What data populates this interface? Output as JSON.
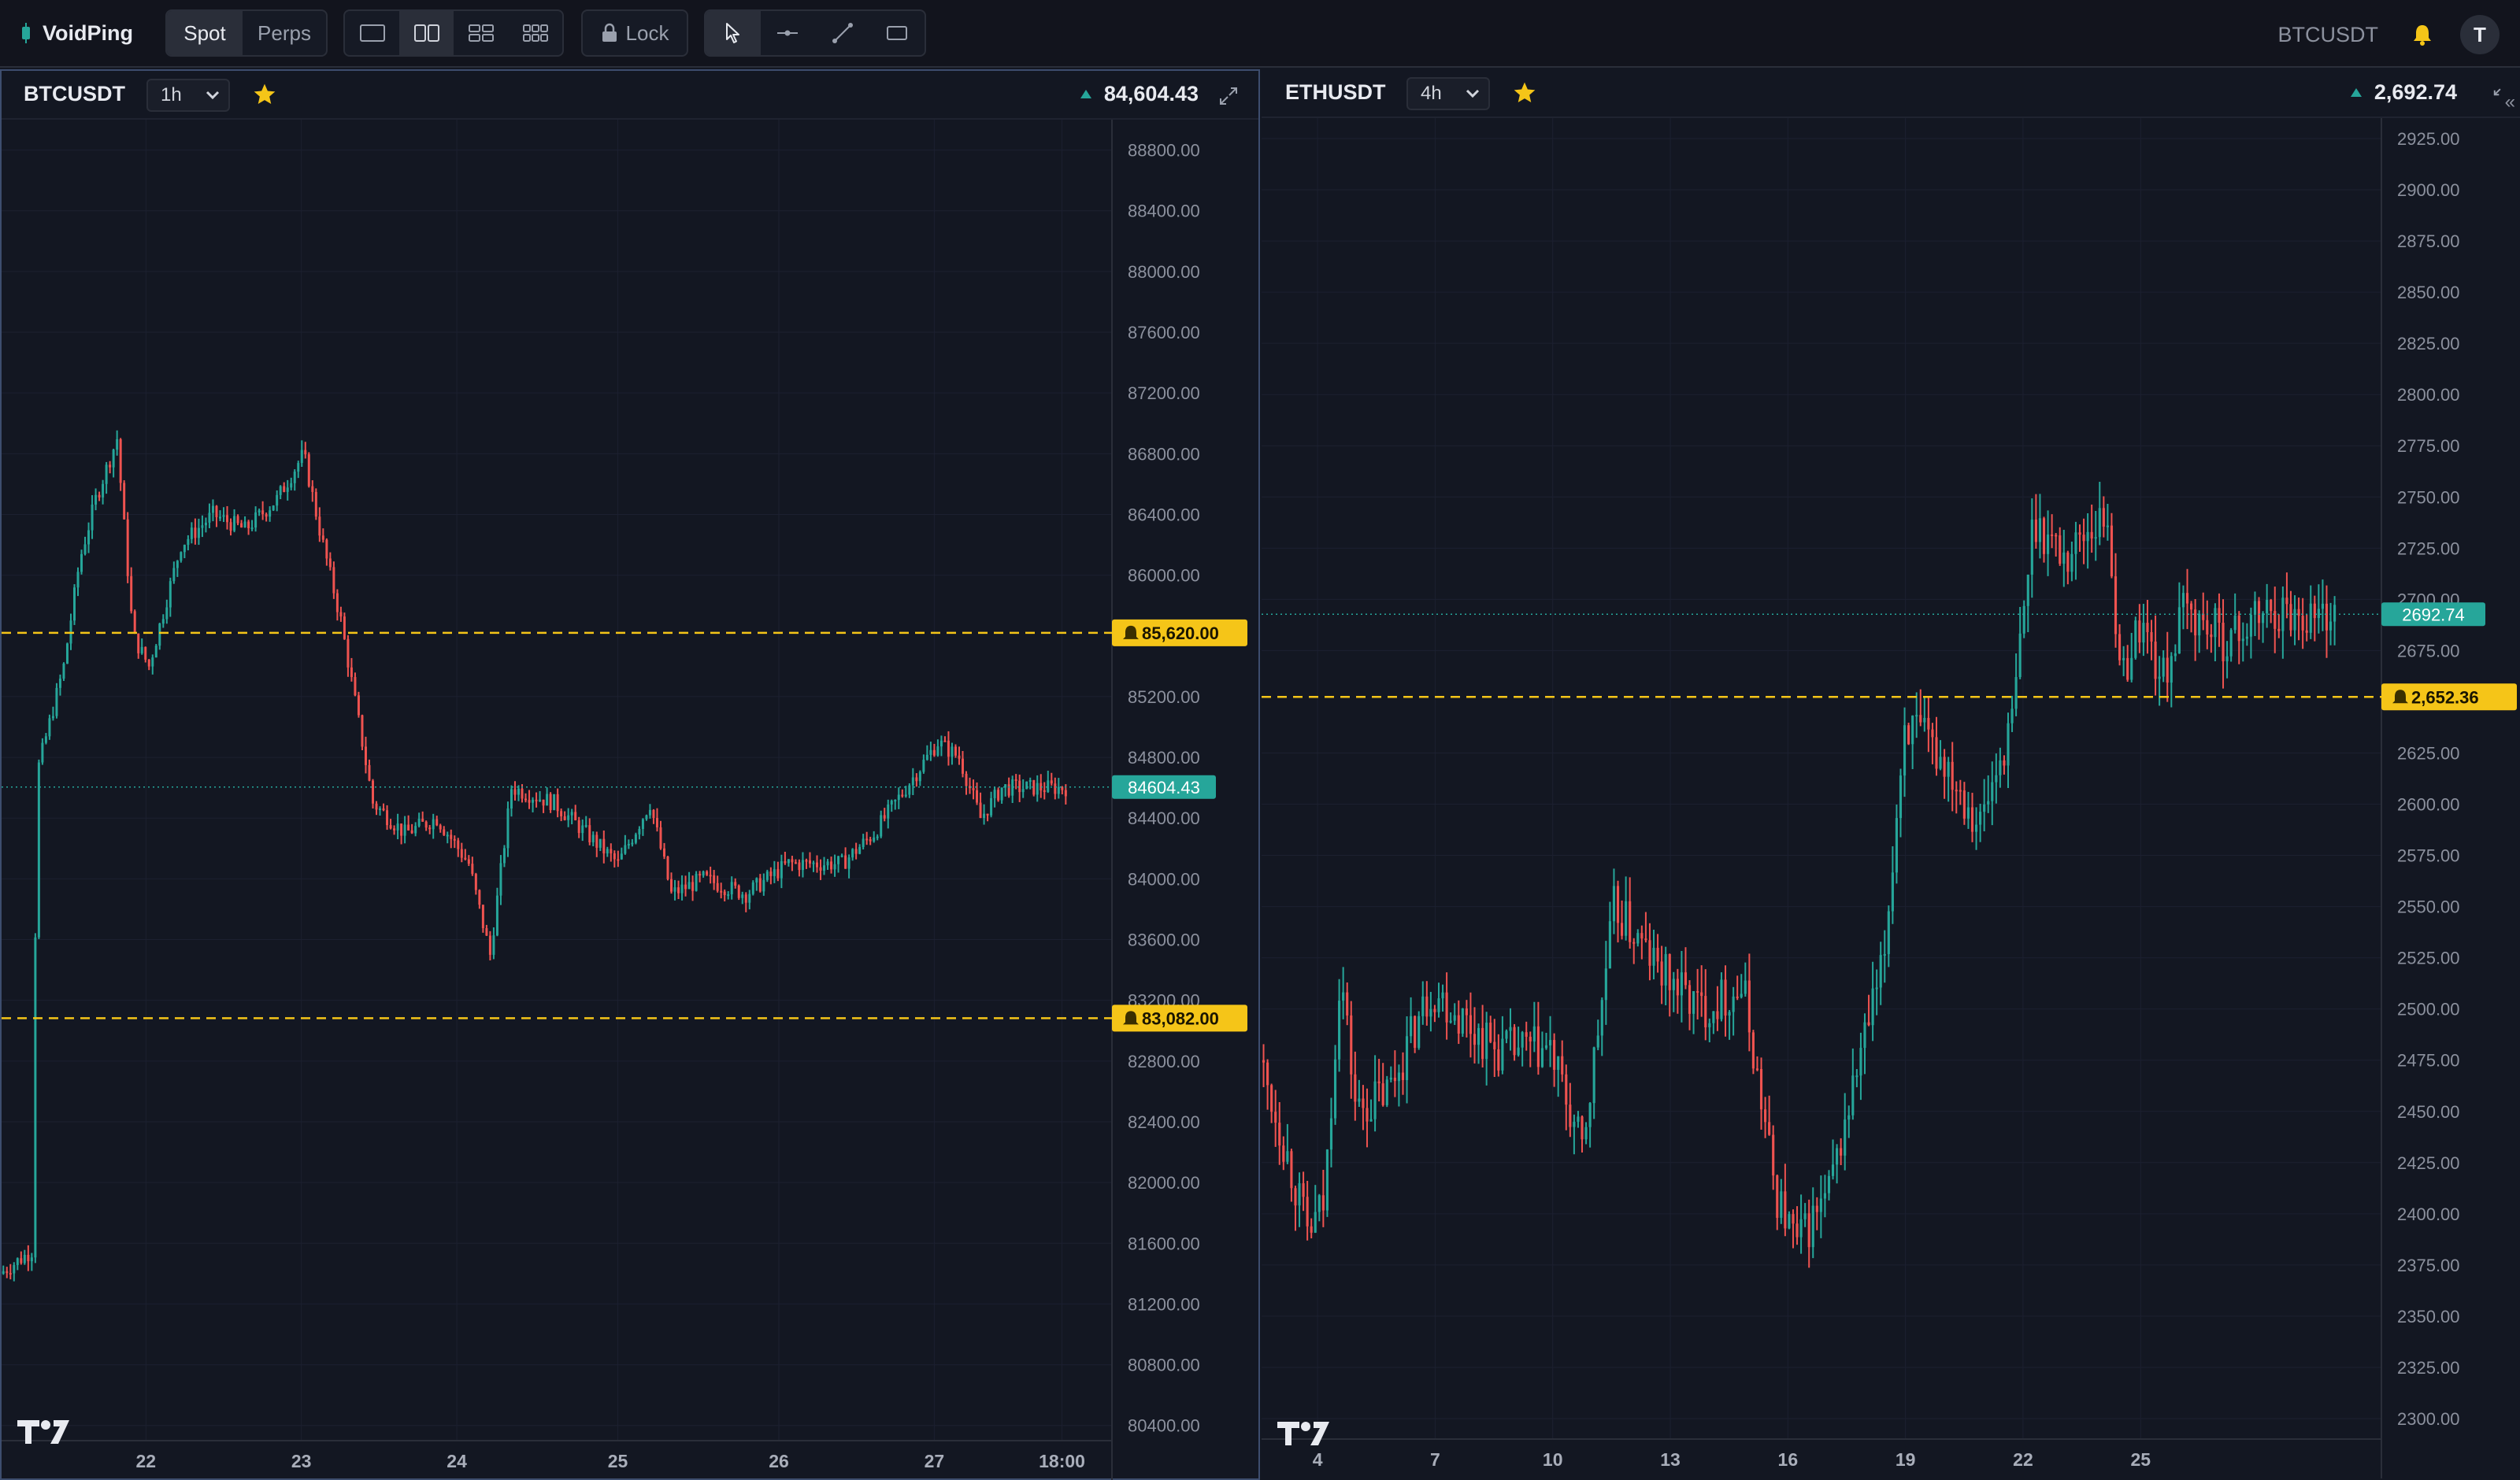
{
  "app": {
    "name": "VoidPing",
    "market_tabs": [
      "Spot",
      "Perps"
    ],
    "active_market_tab": "Spot",
    "layout_icons": [
      "single-layout-icon",
      "two-column-layout-icon",
      "four-grid-layout-icon",
      "six-grid-layout-icon"
    ],
    "active_layout": "two-column-layout-icon",
    "lock_label": "Lock",
    "tool_icons": [
      "cursor-icon",
      "horizontal-line-icon",
      "trend-line-icon",
      "rectangle-icon"
    ],
    "active_tool": "cursor-icon",
    "active_symbol": "BTCUSDT",
    "notification_icon": "bell-icon",
    "avatar_initial": "T",
    "colors": {
      "up": "#26a69a",
      "down": "#ef5350",
      "alert": "#f5c518",
      "panel_border": "#3d4d6e"
    }
  },
  "charts": [
    {
      "symbol": "BTCUSDT",
      "interval": "1h",
      "favorite": true,
      "last_price_display": "84,604.43",
      "last_price_tag": "84604.43",
      "alerts": [
        {
          "label": "85,620.00",
          "value": 85620
        },
        {
          "label": "83,082.00",
          "value": 83082
        }
      ],
      "y_ticks": [
        "88800.00",
        "88400.00",
        "88000.00",
        "87600.00",
        "87200.00",
        "86800.00",
        "86400.00",
        "86000.00",
        "85200.00",
        "84800.00",
        "84400.00",
        "84000.00",
        "83600.00",
        "83200.00",
        "82800.00",
        "82400.00",
        "82000.00",
        "81600.00",
        "81200.00",
        "80800.00",
        "80400.00"
      ],
      "x_ticks": [
        "22",
        "23",
        "24",
        "25",
        "26",
        "27",
        "18:00"
      ]
    },
    {
      "symbol": "ETHUSDT",
      "interval": "4h",
      "favorite": true,
      "last_price_display": "2,692.74",
      "last_price_tag": "2692.74",
      "alerts": [
        {
          "label": "2,652.36",
          "value": 2652.36
        }
      ],
      "y_ticks": [
        "2925.00",
        "2900.00",
        "2875.00",
        "2850.00",
        "2825.00",
        "2800.00",
        "2775.00",
        "2750.00",
        "2725.00",
        "2700.00",
        "2675.00",
        "2625.00",
        "2600.00",
        "2575.00",
        "2550.00",
        "2525.00",
        "2500.00",
        "2475.00",
        "2450.00",
        "2425.00",
        "2400.00",
        "2375.00",
        "2350.00",
        "2325.00",
        "2300.00"
      ],
      "x_ticks": [
        "4",
        "7",
        "10",
        "13",
        "16",
        "19",
        "22",
        "25"
      ]
    }
  ],
  "chart_data": [
    {
      "type": "candlestick",
      "title": "BTCUSDT 1h",
      "x_tick_labels": [
        "22",
        "23",
        "24",
        "25",
        "26",
        "27",
        "18:00"
      ],
      "ylim": [
        80300,
        89000
      ],
      "last_price": 84604.43,
      "alert_lines": [
        85620,
        83082
      ],
      "path": [
        [
          0,
          81400
        ],
        [
          0.03,
          81550
        ],
        [
          0.035,
          84700
        ],
        [
          0.06,
          85400
        ],
        [
          0.075,
          86100
        ],
        [
          0.09,
          86500
        ],
        [
          0.11,
          86900
        ],
        [
          0.125,
          85600
        ],
        [
          0.14,
          85400
        ],
        [
          0.17,
          86200
        ],
        [
          0.2,
          86400
        ],
        [
          0.23,
          86300
        ],
        [
          0.26,
          86500
        ],
        [
          0.285,
          86800
        ],
        [
          0.3,
          86300
        ],
        [
          0.32,
          85700
        ],
        [
          0.35,
          84500
        ],
        [
          0.38,
          84300
        ],
        [
          0.41,
          84400
        ],
        [
          0.44,
          84100
        ],
        [
          0.46,
          83500
        ],
        [
          0.48,
          84600
        ],
        [
          0.52,
          84500
        ],
        [
          0.55,
          84300
        ],
        [
          0.58,
          84100
        ],
        [
          0.61,
          84500
        ],
        [
          0.63,
          83900
        ],
        [
          0.66,
          84000
        ],
        [
          0.7,
          83900
        ],
        [
          0.74,
          84100
        ],
        [
          0.79,
          84100
        ],
        [
          0.82,
          84300
        ],
        [
          0.85,
          84600
        ],
        [
          0.88,
          84900
        ],
        [
          0.9,
          84800
        ],
        [
          0.92,
          84400
        ],
        [
          0.94,
          84600
        ]
      ]
    },
    {
      "type": "candlestick",
      "title": "ETHUSDT 4h",
      "x_tick_labels": [
        "4",
        "7",
        "10",
        "13",
        "16",
        "19",
        "22",
        "25"
      ],
      "ylim": [
        2290,
        2935
      ],
      "last_price": 2692.74,
      "alert_lines": [
        2652.36
      ],
      "path": [
        [
          0,
          2475
        ],
        [
          0.02,
          2440
        ],
        [
          0.045,
          2390
        ],
        [
          0.06,
          2405
        ],
        [
          0.075,
          2520
        ],
        [
          0.09,
          2450
        ],
        [
          0.12,
          2460
        ],
        [
          0.16,
          2510
        ],
        [
          0.22,
          2480
        ],
        [
          0.27,
          2480
        ],
        [
          0.3,
          2430
        ],
        [
          0.33,
          2550
        ],
        [
          0.37,
          2520
        ],
        [
          0.41,
          2500
        ],
        [
          0.45,
          2510
        ],
        [
          0.48,
          2410
        ],
        [
          0.5,
          2385
        ],
        [
          0.53,
          2410
        ],
        [
          0.56,
          2480
        ],
        [
          0.58,
          2520
        ],
        [
          0.6,
          2640
        ],
        [
          0.64,
          2620
        ],
        [
          0.67,
          2590
        ],
        [
          0.7,
          2640
        ],
        [
          0.72,
          2740
        ],
        [
          0.75,
          2720
        ],
        [
          0.77,
          2735
        ],
        [
          0.79,
          2740
        ],
        [
          0.8,
          2660
        ],
        [
          0.82,
          2690
        ],
        [
          0.84,
          2660
        ],
        [
          0.86,
          2695
        ],
        [
          0.9,
          2680
        ],
        [
          0.94,
          2695
        ],
        [
          0.97,
          2692.74
        ]
      ]
    }
  ]
}
